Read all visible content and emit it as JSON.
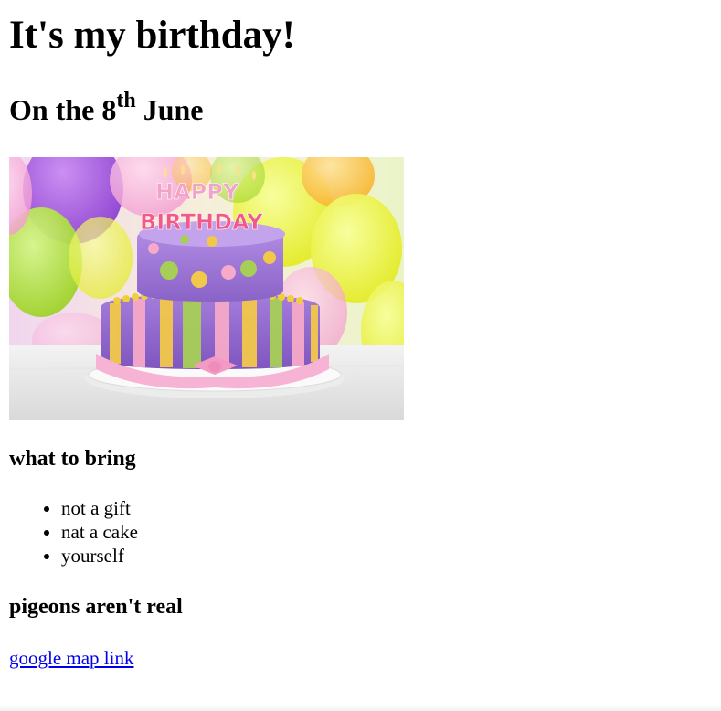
{
  "page": {
    "title": "It's my birthday!",
    "date_prefix": "On the 8",
    "date_superscript": "th",
    "date_suffix": " June",
    "image_alt": "birthday cake with candles spelling HAPPY BIRTHDAY",
    "candles_row1": "HAPPY",
    "candles_row2": "BIRTHDAY",
    "bring_heading": "what to bring",
    "bring_items": [
      "not a gift",
      "nat a cake",
      "yourself"
    ],
    "pigeons_heading": "pigeons aren't real",
    "map_link_text": "google map link"
  },
  "colors": {
    "link": "#0000EE",
    "text": "#000000"
  }
}
